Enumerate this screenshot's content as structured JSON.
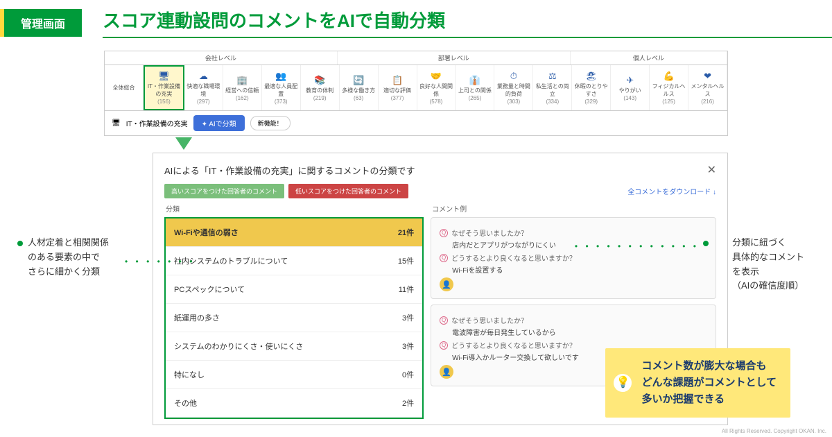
{
  "header": {
    "badge": "管理画面",
    "title": "スコア連動設問のコメントをAIで自動分類"
  },
  "levels": [
    "会社レベル",
    "部署レベル",
    "個人レベル"
  ],
  "cats": [
    {
      "icon": "",
      "name": "全体総合",
      "count": ""
    },
    {
      "icon": "🖥",
      "name": "IT・作業設備の充実",
      "count": "(156)"
    },
    {
      "icon": "☁",
      "name": "快適な職場環境",
      "count": "(297)"
    },
    {
      "icon": "🏢",
      "name": "経営への信頼",
      "count": "(162)"
    },
    {
      "icon": "👥",
      "name": "最適な人員配置",
      "count": "(373)"
    },
    {
      "icon": "📚",
      "name": "教育の体制",
      "count": "(219)"
    },
    {
      "icon": "🔄",
      "name": "多様な働き方",
      "count": "(63)"
    },
    {
      "icon": "📋",
      "name": "適切な評価",
      "count": "(377)"
    },
    {
      "icon": "🤝",
      "name": "良好な人間関係",
      "count": "(578)"
    },
    {
      "icon": "👔",
      "name": "上司との関係",
      "count": "(265)"
    },
    {
      "icon": "⏱",
      "name": "業務量と時間的負荷",
      "count": "(303)"
    },
    {
      "icon": "⚖",
      "name": "私生活との両立",
      "count": "(334)"
    },
    {
      "icon": "🏖",
      "name": "休暇のとりやすさ",
      "count": "(329)"
    },
    {
      "icon": "✈",
      "name": "やりがい",
      "count": "(143)"
    },
    {
      "icon": "💪",
      "name": "フィジカルヘルス",
      "count": "(125)"
    },
    {
      "icon": "❤",
      "name": "メンタルヘルス",
      "count": "(216)"
    }
  ],
  "toolbar": {
    "current": "IT・作業設備の充実",
    "ai": "✦ AIで分類",
    "new": "新機能！"
  },
  "panel2": {
    "title": "AIによる「IT・作業設備の充実」に関するコメントの分類です",
    "tab_high": "高いスコアをつけた回答者のコメント",
    "tab_low": "低いスコアをつけた回答者のコメント",
    "download": "全コメントをダウンロード ↓",
    "col_class": "分類",
    "col_example": "コメント例"
  },
  "classes": [
    {
      "name": "Wi-Fiや通信の弱さ",
      "count": "21件"
    },
    {
      "name": "社内システムのトラブルについて",
      "count": "15件"
    },
    {
      "name": "PCスペックについて",
      "count": "11件"
    },
    {
      "name": "紙運用の多さ",
      "count": "3件"
    },
    {
      "name": "システムのわかりにくさ・使いにくさ",
      "count": "3件"
    },
    {
      "name": "特になし",
      "count": "0件"
    },
    {
      "name": "その他",
      "count": "2件"
    }
  ],
  "comments": [
    {
      "q1": "なぜそう思いましたか？",
      "a1": "店内だとアプリがつながりにくい",
      "q2": "どうするとより良くなると思いますか？",
      "a2": "Wi-Fiを設置する"
    },
    {
      "q1": "なぜそう思いましたか？",
      "a1": "電波障害が毎日発生しているから",
      "q2": "どうするとより良くなると思いますか？",
      "a2": "Wi-Fi導入かルーター交換して欲しいです"
    }
  ],
  "callout_left": "人材定着と相関関係\nのある要素の中で\nさらに細かく分類",
  "callout_right": "分類に紐づく\n具体的なコメント\nを表示\n（AIの確信度順）",
  "note": "コメント数が膨大な場合も\nどんな課題がコメントとして\n多いか把握できる",
  "copyright": "All Rights Reserved. Copyright OKAN. Inc."
}
